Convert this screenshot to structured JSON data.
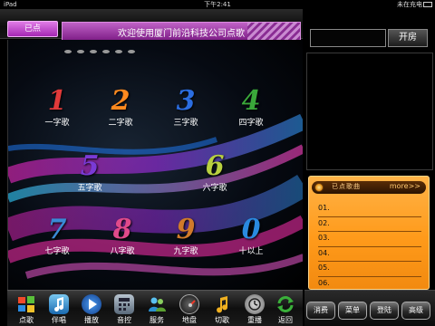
{
  "status_bar": {
    "device": "iPad",
    "time": "下午2:41",
    "battery": "未在充电"
  },
  "header": {
    "played_tab": "已点",
    "marquee": "欢迎使用厦门前沿科技公司点歌"
  },
  "song_length_buttons": [
    {
      "number": "1",
      "label": "一字歌",
      "color": "#e23a3a"
    },
    {
      "number": "2",
      "label": "二字歌",
      "color": "#ff8a1f"
    },
    {
      "number": "3",
      "label": "三字歌",
      "color": "#2b6de0"
    },
    {
      "number": "4",
      "label": "四字歌",
      "color": "#3aa83a"
    },
    {
      "number": "5",
      "label": "五字歌",
      "color": "#7a3ad6"
    },
    {
      "number": "6",
      "label": "六字歌",
      "color": "#b8d040"
    },
    {
      "number": "7",
      "label": "七字歌",
      "color": "#3a8ad6"
    },
    {
      "number": "8",
      "label": "八字歌",
      "color": "#e04a8a"
    },
    {
      "number": "9",
      "label": "九字歌",
      "color": "#d07a2a"
    },
    {
      "number": "0",
      "label": "十以上",
      "color": "#2a8ae0"
    }
  ],
  "room": {
    "input_value": "",
    "open_button": "开房"
  },
  "queue": {
    "title": "已点歌曲",
    "more": "more>>",
    "rows": [
      "01.",
      "02.",
      "03.",
      "04.",
      "05.",
      "06."
    ]
  },
  "toolbar": [
    {
      "label": "点歌",
      "icon": "windows-logo-icon",
      "color": "#3a7ad6"
    },
    {
      "label": "伴唱",
      "icon": "music-note-icon",
      "color": "#3a9ad6"
    },
    {
      "label": "播放",
      "icon": "play-icon",
      "color": "#2a6ac6"
    },
    {
      "label": "音控",
      "icon": "calculator-icon",
      "color": "#6a7a8a"
    },
    {
      "label": "服务",
      "icon": "people-icon",
      "color": "#3aa0d0"
    },
    {
      "label": "地盘",
      "icon": "gauge-icon",
      "color": "#444444"
    },
    {
      "label": "切歌",
      "icon": "music-note-icon",
      "color": "#e0a020"
    },
    {
      "label": "重播",
      "icon": "clock-icon",
      "color": "#8a8a8a"
    },
    {
      "label": "返回",
      "icon": "refresh-icon",
      "color": "#3ab03a"
    }
  ],
  "bottom_buttons": [
    "消费",
    "菜单",
    "登陆",
    "高级"
  ]
}
